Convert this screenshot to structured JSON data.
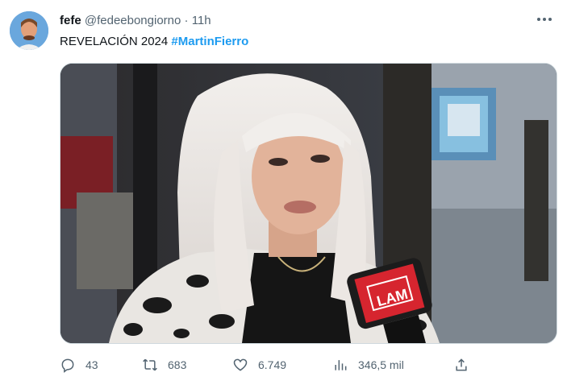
{
  "author": {
    "name": "fefe",
    "handle": "@fedeebongiorno",
    "separator": "·",
    "time": "11h"
  },
  "tweet": {
    "text": "REVELACIÓN 2024 ",
    "hashtag": "#MartinFierro"
  },
  "media": {
    "mic_logo": "LAM"
  },
  "actions": {
    "replies": "43",
    "retweets": "683",
    "likes": "6.749",
    "views": "346,5 mil"
  },
  "colors": {
    "accent": "#1d9bf0",
    "muted": "#536471"
  }
}
